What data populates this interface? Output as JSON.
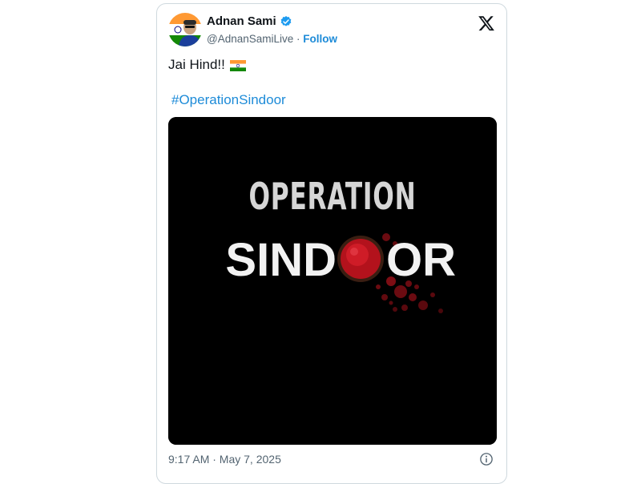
{
  "author": {
    "name": "Adnan Sami",
    "handle": "@AdnanSamiLive",
    "separator": " · ",
    "follow_label": "Follow",
    "verified": true
  },
  "brand": {
    "logo_icon": "x-logo-icon"
  },
  "tweet": {
    "text": "Jai Hind!!",
    "emoji_icon": "india-flag-icon",
    "hashtag": "#OperationSindoor"
  },
  "media": {
    "line1": "OPERATION",
    "line2_left": "SIND",
    "line2_right": "OR",
    "colors": {
      "background": "#000000",
      "sindoor": "#c4121f"
    }
  },
  "footer": {
    "timestamp": "9:17 AM · May 7, 2025",
    "info_icon": "info-icon"
  },
  "colors": {
    "link": "#1d8bd8",
    "text": "#0f1419",
    "muted": "#536471",
    "verified": "#1d9bf0"
  }
}
